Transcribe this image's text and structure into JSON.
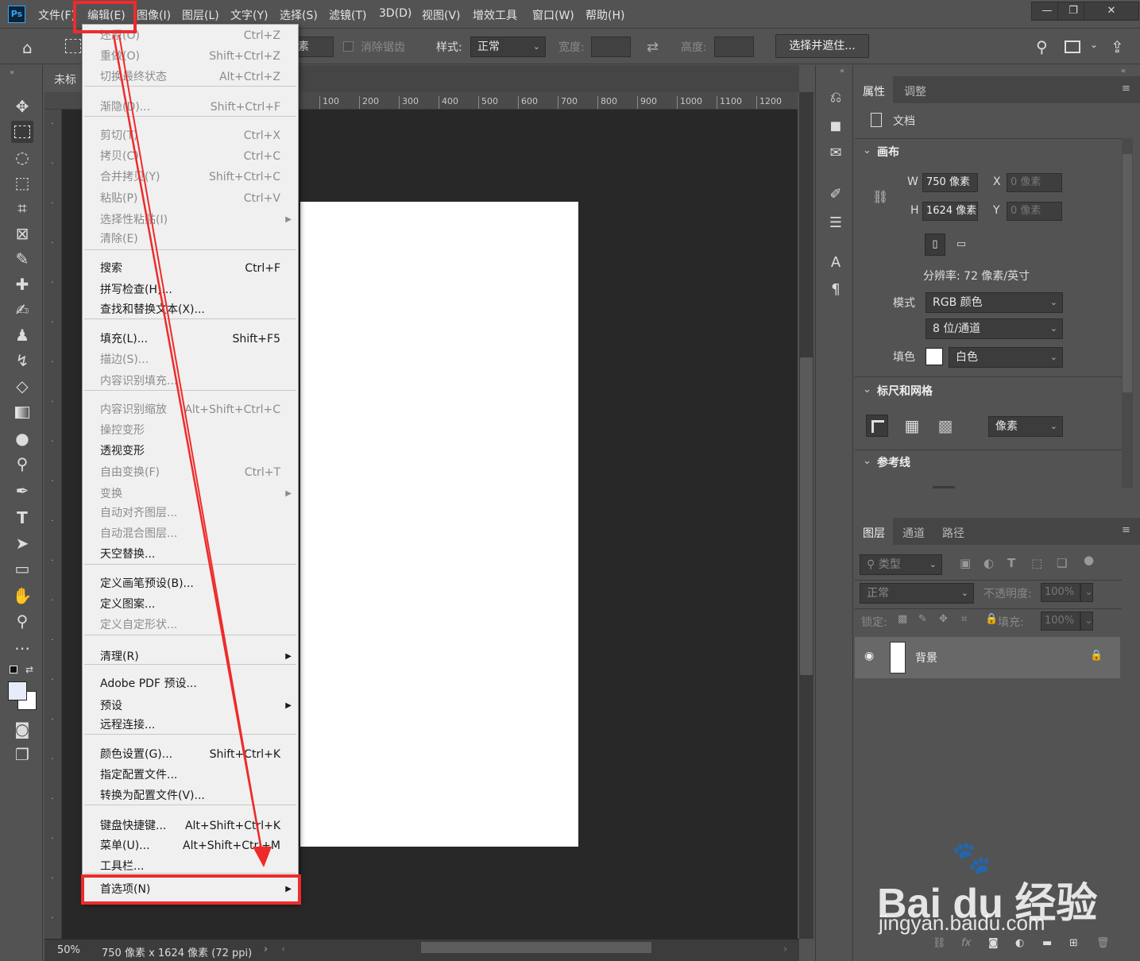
{
  "app": {
    "logo": "Ps"
  },
  "menubar": {
    "items": [
      "文件(F)",
      "编辑(E)",
      "图像(I)",
      "图层(L)",
      "文字(Y)",
      "选择(S)",
      "滤镜(T)",
      "3D(D)",
      "视图(V)",
      "增效工具",
      "窗口(W)",
      "帮助(H)"
    ]
  },
  "window_controls": {
    "minimize": "—",
    "restore": "❐",
    "close": "✕"
  },
  "options": {
    "feather_value": "素",
    "antialias": "消除锯齿",
    "style_label": "样式:",
    "style_value": "正常",
    "width_label": "宽度:",
    "height_label": "高度:",
    "select_mask": "选择并遮住..."
  },
  "document": {
    "tab": "未标",
    "zoom": "50%",
    "info": "750 像素 x 1624 像素 (72 ppi)"
  },
  "ruler": {
    "h_ticks": [
      "100",
      "200",
      "300",
      "400",
      "500",
      "600",
      "700",
      "800",
      "900",
      "1000",
      "1100",
      "1200"
    ]
  },
  "edit_menu": {
    "items": [
      {
        "label": "还原(O)",
        "shortcut": "Ctrl+Z",
        "disabled": true
      },
      {
        "label": "重做(O)",
        "shortcut": "Shift+Ctrl+Z",
        "disabled": true
      },
      {
        "label": "切换最终状态",
        "shortcut": "Alt+Ctrl+Z",
        "disabled": true
      },
      {
        "label": "渐隐(D)...",
        "shortcut": "Shift+Ctrl+F",
        "disabled": true
      },
      {
        "label": "剪切(T)",
        "shortcut": "Ctrl+X",
        "disabled": true
      },
      {
        "label": "拷贝(C)",
        "shortcut": "Ctrl+C",
        "disabled": true
      },
      {
        "label": "合并拷贝(Y)",
        "shortcut": "Shift+Ctrl+C",
        "disabled": true
      },
      {
        "label": "粘贴(P)",
        "shortcut": "Ctrl+V",
        "disabled": true
      },
      {
        "label": "选择性粘贴(I)",
        "shortcut": "",
        "disabled": true
      },
      {
        "label": "清除(E)",
        "shortcut": "",
        "disabled": true
      },
      {
        "label": "搜索",
        "shortcut": "Ctrl+F",
        "disabled": false
      },
      {
        "label": "拼写检查(H)...",
        "shortcut": "",
        "disabled": false
      },
      {
        "label": "查找和替换文本(X)...",
        "shortcut": "",
        "disabled": false
      },
      {
        "label": "填充(L)...",
        "shortcut": "Shift+F5",
        "disabled": false
      },
      {
        "label": "描边(S)...",
        "shortcut": "",
        "disabled": true
      },
      {
        "label": "内容识别填充...",
        "shortcut": "",
        "disabled": true
      },
      {
        "label": "内容识别缩放",
        "shortcut": "Alt+Shift+Ctrl+C",
        "disabled": true
      },
      {
        "label": "操控变形",
        "shortcut": "",
        "disabled": true
      },
      {
        "label": "透视变形",
        "shortcut": "",
        "disabled": false
      },
      {
        "label": "自由变换(F)",
        "shortcut": "Ctrl+T",
        "disabled": true
      },
      {
        "label": "变换",
        "shortcut": "",
        "disabled": true
      },
      {
        "label": "自动对齐图层...",
        "shortcut": "",
        "disabled": true
      },
      {
        "label": "自动混合图层...",
        "shortcut": "",
        "disabled": true
      },
      {
        "label": "天空替换...",
        "shortcut": "",
        "disabled": false
      },
      {
        "label": "定义画笔预设(B)...",
        "shortcut": "",
        "disabled": false
      },
      {
        "label": "定义图案...",
        "shortcut": "",
        "disabled": false
      },
      {
        "label": "定义自定形状...",
        "shortcut": "",
        "disabled": true
      },
      {
        "label": "清理(R)",
        "shortcut": "",
        "disabled": false
      },
      {
        "label": "Adobe PDF 预设...",
        "shortcut": "",
        "disabled": false
      },
      {
        "label": "预设",
        "shortcut": "",
        "disabled": false
      },
      {
        "label": "远程连接...",
        "shortcut": "",
        "disabled": false
      },
      {
        "label": "颜色设置(G)...",
        "shortcut": "Shift+Ctrl+K",
        "disabled": false
      },
      {
        "label": "指定配置文件...",
        "shortcut": "",
        "disabled": false
      },
      {
        "label": "转换为配置文件(V)...",
        "shortcut": "",
        "disabled": false
      },
      {
        "label": "键盘快捷键...",
        "shortcut": "Alt+Shift+Ctrl+K",
        "disabled": false
      },
      {
        "label": "菜单(U)...",
        "shortcut": "Alt+Shift+Ctrl+M",
        "disabled": false
      },
      {
        "label": "工具栏...",
        "shortcut": "",
        "disabled": false
      },
      {
        "label": "首选项(N)",
        "shortcut": "",
        "disabled": false
      }
    ]
  },
  "properties": {
    "tab_active": "属性",
    "tab_other": "调整",
    "doc_label": "文档",
    "canvas_section": "画布",
    "w_label": "W",
    "w_value": "750 像素",
    "h_label": "H",
    "h_value": "1624 像素",
    "x_label": "X",
    "x_value": "0 像素",
    "y_label": "Y",
    "y_value": "0 像素",
    "resolution": "分辨率: 72 像素/英寸",
    "mode_label": "模式",
    "mode_value": "RGB 颜色",
    "depth_value": "8 位/通道",
    "fill_label": "填色",
    "fill_value": "白色",
    "rulers_section": "标尺和网格",
    "units_value": "像素",
    "guides_section": "参考线"
  },
  "layers": {
    "tabs": [
      "图层",
      "通道",
      "路径"
    ],
    "filter_placeholder": "类型",
    "blend_mode": "正常",
    "opacity_label": "不透明度:",
    "opacity_value": "100%",
    "lock_label": "锁定:",
    "fill_label": "填充:",
    "fill_value": "100%",
    "layer_name": "背景"
  },
  "watermark": {
    "brand": "Bai du 经验",
    "url": "jingyan.baidu.com"
  },
  "colors": {
    "annotation": "#ee2b2b",
    "menu_bg": "#f0f0f0",
    "canvas_bg": "#282828",
    "panel_bg": "#535353"
  }
}
